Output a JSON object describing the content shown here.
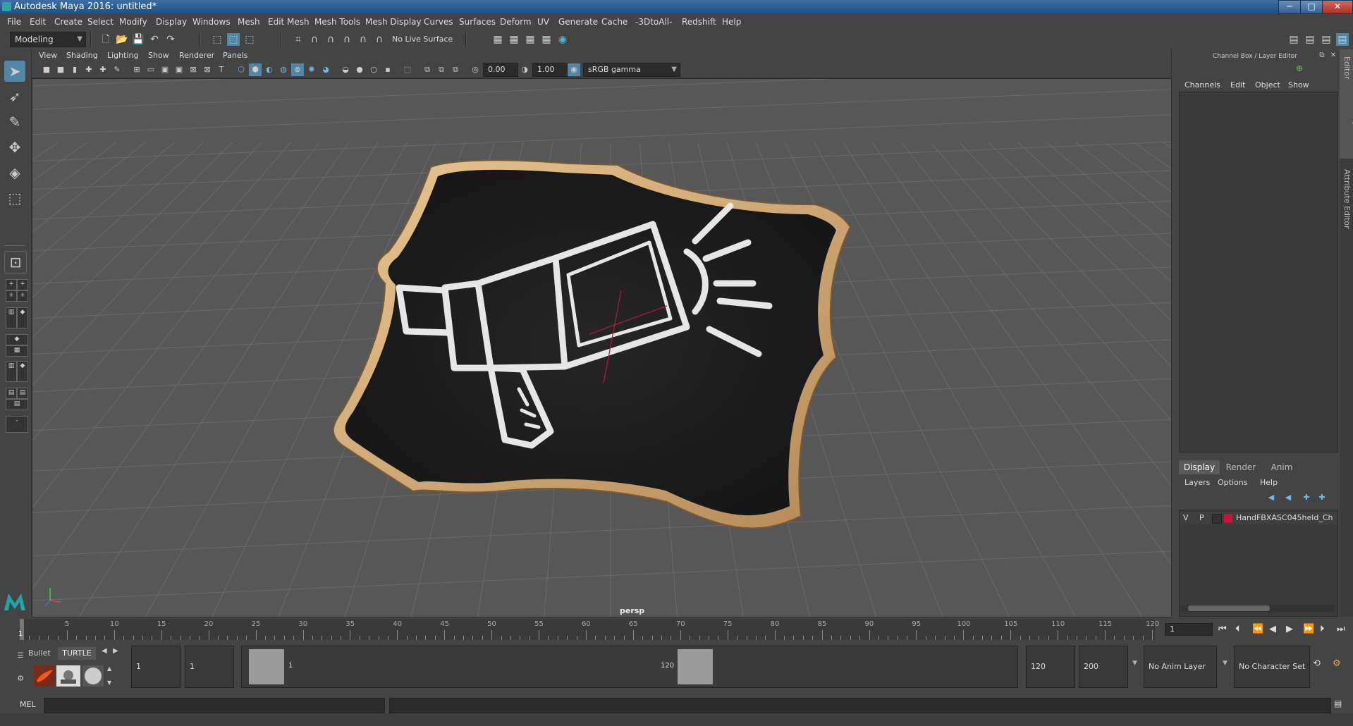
{
  "window": {
    "title": "Autodesk Maya 2016: untitled*",
    "minimize": "─",
    "maximize": "□",
    "close": "✕"
  },
  "menubar": [
    "File",
    "Edit",
    "Create",
    "Select",
    "Modify",
    "Display",
    "Windows",
    "Mesh",
    "Edit Mesh",
    "Mesh Tools",
    "Mesh Display",
    "Curves",
    "Surfaces",
    "Deform",
    "UV",
    "Generate",
    "Cache",
    "-3DtoAll-",
    "Redshift",
    "Help"
  ],
  "shelf": {
    "mode": "Modeling",
    "live_surface": "No Live Surface"
  },
  "viewport": {
    "menu": [
      "View",
      "Shading",
      "Lighting",
      "Show",
      "Renderer",
      "Panels"
    ],
    "exposure": "0.00",
    "gamma": "1.00",
    "color_space": "sRGB gamma",
    "camera": "persp"
  },
  "channel_box": {
    "header": "Channel Box / Layer Editor",
    "menu": [
      "Channels",
      "Edit",
      "Object",
      "Show"
    ],
    "side_tab_1": "Channel Box / Layer Editor",
    "side_tab_2": "Attribute Editor"
  },
  "layer_editor": {
    "tabs": [
      "Display",
      "Render",
      "Anim"
    ],
    "menu": [
      "Layers",
      "Options",
      "Help"
    ],
    "layers": [
      {
        "v": "V",
        "p": "P",
        "name": "HandFBXASC045held_Ch",
        "color": "#c8143c"
      }
    ]
  },
  "timeline": {
    "ticks": [
      "5",
      "10",
      "15",
      "20",
      "25",
      "30",
      "35",
      "40",
      "45",
      "50",
      "55",
      "60",
      "65",
      "70",
      "75",
      "80",
      "85",
      "90",
      "95",
      "100",
      "105",
      "110",
      "115",
      "120"
    ],
    "start_marker": "1",
    "current_frame": "1"
  },
  "range": {
    "shelf_tabs": [
      "Bullet",
      "TURTLE"
    ],
    "start_time": "1",
    "playback_start": "1",
    "slider_start": "1",
    "slider_end": "120",
    "playback_end": "120",
    "end_time": "200",
    "anim_layer": "No Anim Layer",
    "character_set": "No Character Set"
  },
  "mel": {
    "label": "MEL"
  },
  "colors": {
    "accent": "#5285a6",
    "board": "#1d1d1d",
    "frame": "#d9b27c",
    "chalk": "#e6e6e6"
  }
}
